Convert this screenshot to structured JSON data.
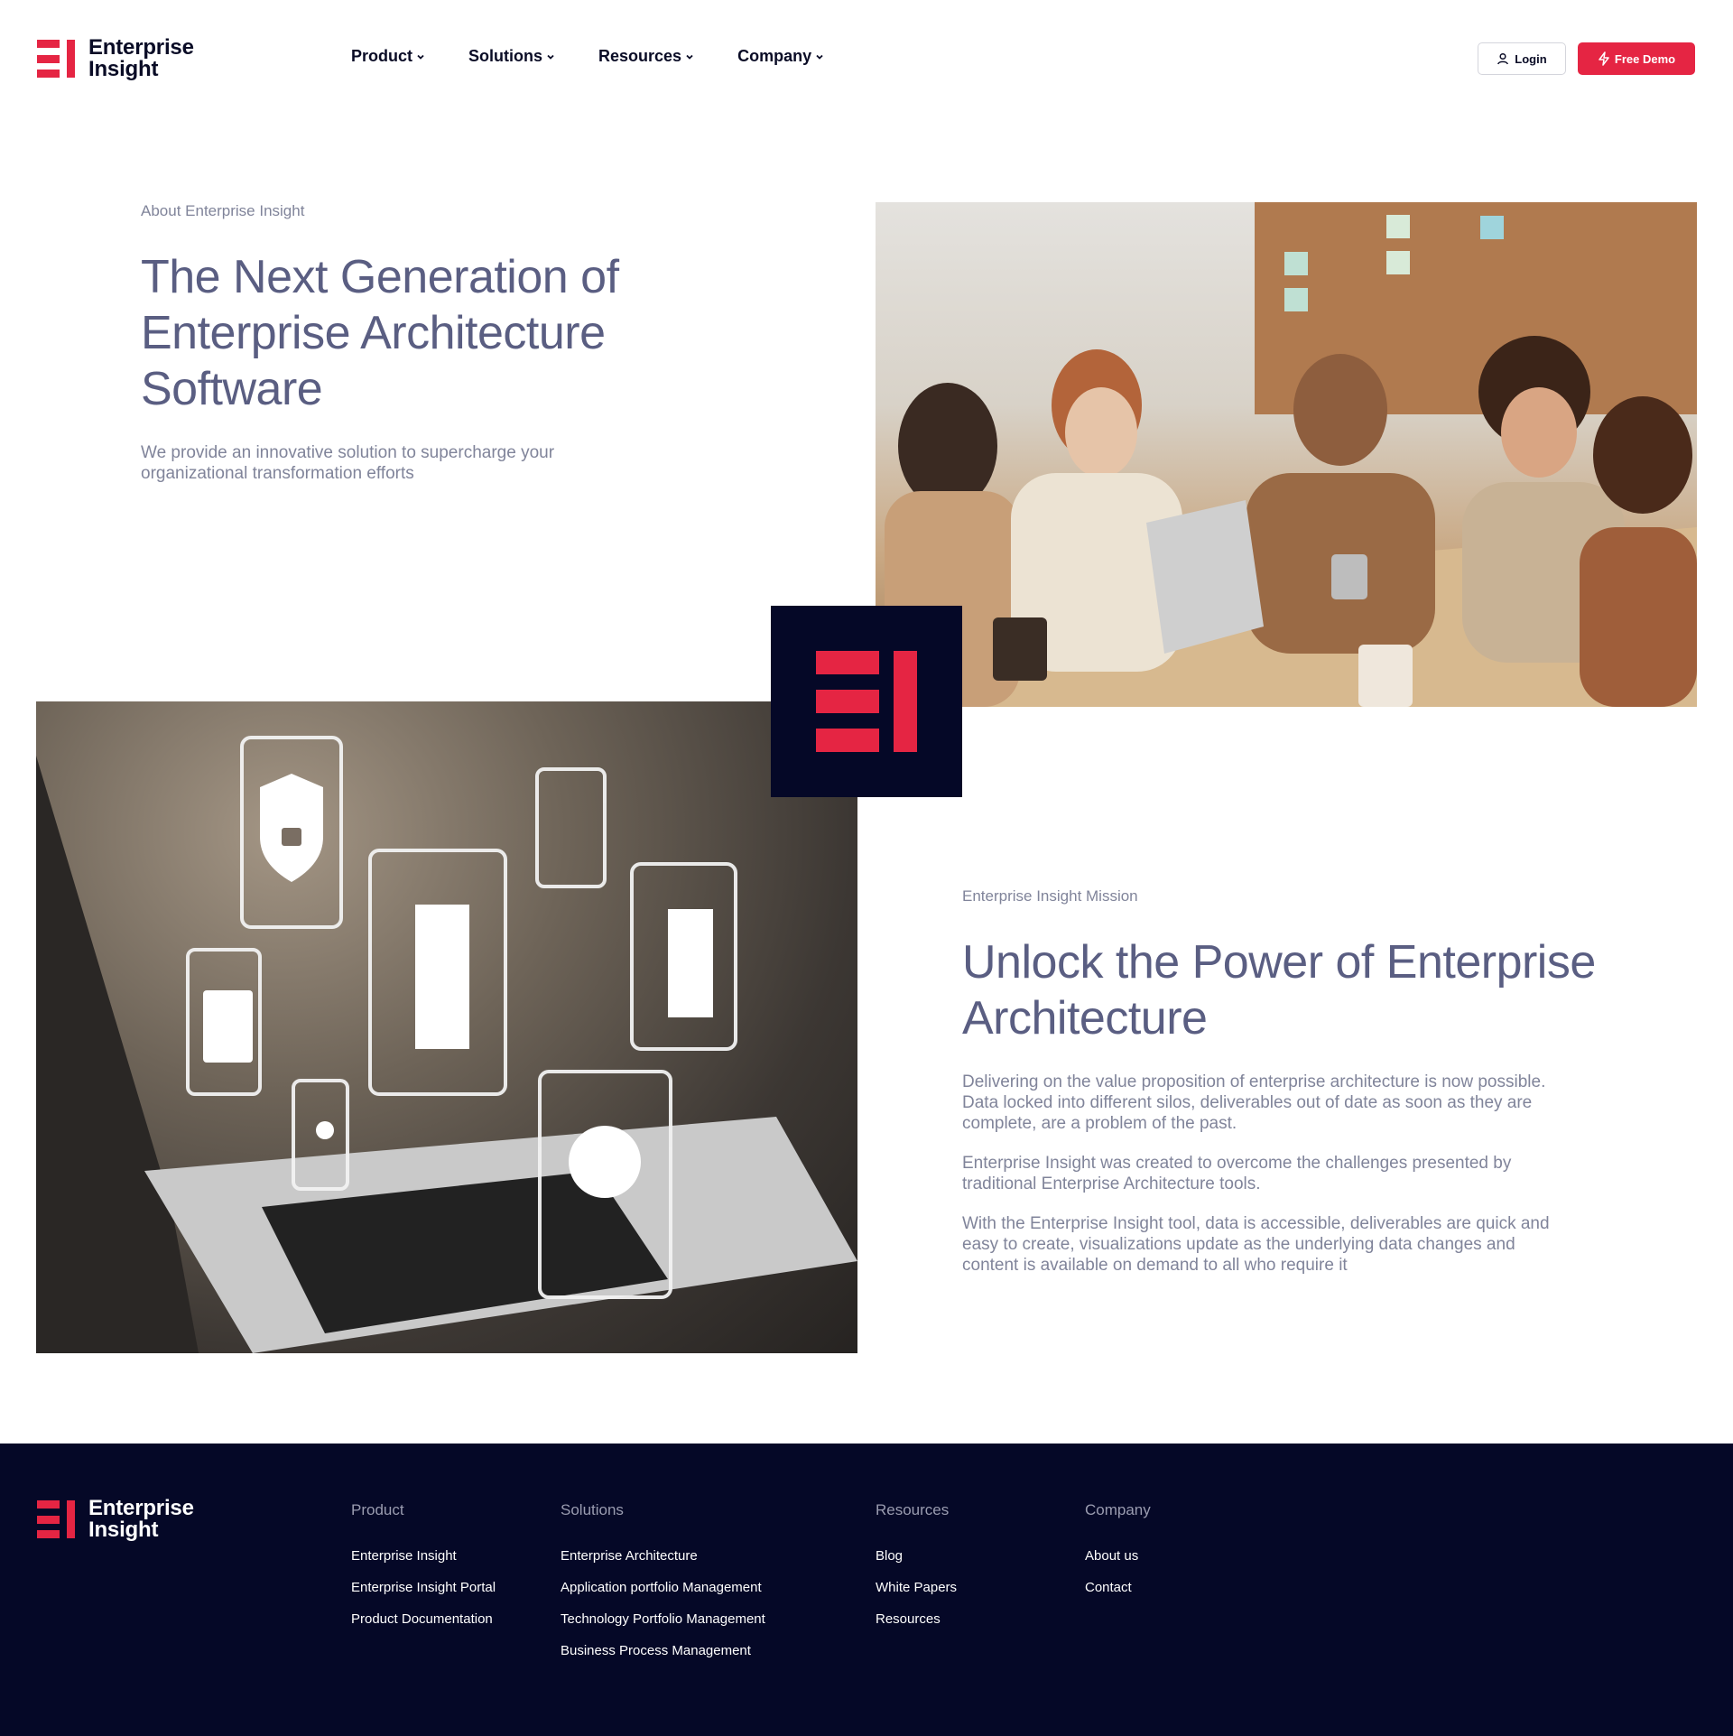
{
  "brand": {
    "line1": "Enterprise",
    "line2": "Insight",
    "accent": "#e52543",
    "navy": "#050827"
  },
  "nav": {
    "items": [
      {
        "label": "Product"
      },
      {
        "label": "Solutions"
      },
      {
        "label": "Resources"
      },
      {
        "label": "Company"
      }
    ],
    "login_label": "Login",
    "demo_label": "Free Demo"
  },
  "hero": {
    "eyebrow": "About Enterprise Insight",
    "title": "The Next Generation of Enterprise Architecture Software",
    "subtitle": "We provide an innovative solution to supercharge your organizational transformation efforts"
  },
  "mission": {
    "eyebrow": "Enterprise Insight Mission",
    "title": "Unlock the Power of Enterprise Architecture",
    "paragraphs": [
      "Delivering on the value proposition of enterprise architecture is now possible. Data locked into different silos, deliverables out of date as soon as they are complete, are a problem of the past.",
      "Enterprise Insight was created to overcome the challenges presented by traditional Enterprise Architecture tools.",
      "With the Enterprise Insight tool, data is accessible, deliverables are quick and easy to create, visualizations update as the underlying data changes and content is available on demand to all who require it"
    ]
  },
  "footer": {
    "columns": [
      {
        "heading": "Product",
        "links": [
          "Enterprise Insight",
          "Enterprise Insight Portal",
          "Product Documentation"
        ]
      },
      {
        "heading": "Solutions",
        "links": [
          "Enterprise Architecture",
          "Application portfolio Management",
          "Technology Portfolio Management",
          "Business Process Management"
        ]
      },
      {
        "heading": "Resources",
        "links": [
          "Blog",
          "White Papers",
          "Resources"
        ]
      },
      {
        "heading": "Company",
        "links": [
          "About us",
          "Contact"
        ]
      }
    ]
  }
}
